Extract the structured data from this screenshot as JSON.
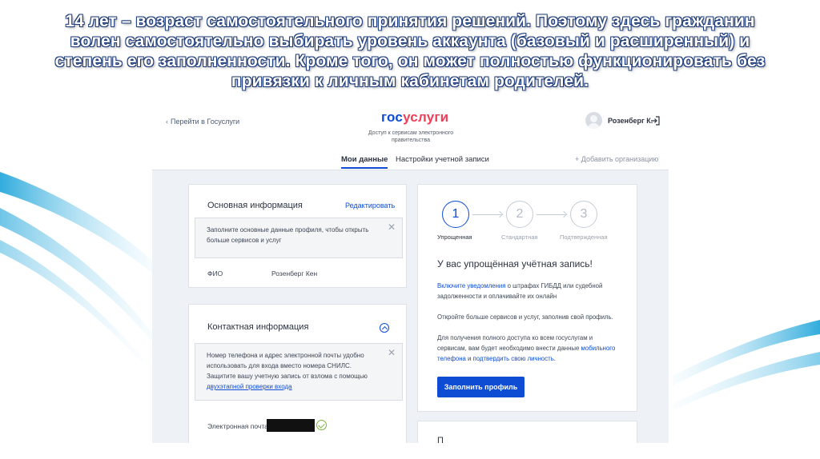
{
  "slide": {
    "heading": "14 лет – возраст самостоятельного принятия решений. Поэтому здесь гражданин волен самостоятельно выбирать уровень аккаунта (базовый и расширенный) и степень его заполненности. Кроме того, он может полностью функционировать без привязки к личным кабинетам родителей."
  },
  "header": {
    "back_link": "Перейти в Госуслуги",
    "logo_part1": "гос",
    "logo_part2": "услуги",
    "tagline": "Доступ к сервисам электронного правительства",
    "user_name": "Розенберг К."
  },
  "tabs": [
    {
      "label": "Мои данные"
    },
    {
      "label": "Настройки учетной записи"
    }
  ],
  "add_org": "+ Добавить организацию",
  "basic_info": {
    "title": "Основная информация",
    "edit": "Редактировать",
    "notice": "Заполните основные данные профиля, чтобы открыть больше сервисов и услуг",
    "fio_label": "ФИО",
    "fio_value": "Розенберг Кен"
  },
  "contact_info": {
    "title": "Контактная информация",
    "notice_line1": "Номер телефона и адрес электронной почты удобно использовать для входа вместо номера СНИЛС.",
    "notice_line2": "Защитите вашу учетную запись от взлома с помощью",
    "notice_link": "двухэтапной проверки входа",
    "email_label": "Электронная почта"
  },
  "account_status": {
    "steps": [
      {
        "number": "1",
        "label": "Упрощенная"
      },
      {
        "number": "2",
        "label": "Стандартная"
      },
      {
        "number": "3",
        "label": "Подтвержденная"
      }
    ],
    "title": "У вас упрощённая учётная запись!",
    "p1_link": "Включите уведомления",
    "p1_text": " о штрафах ГИБДД или судебной задолженности и оплачивайте их онлайн",
    "p2": "Откройте больше сервисов и услуг, заполнив свой профиль.",
    "p3_text": "Для получения полного доступа ко всем госуслугам и сервисам, вам будет необходимо внести данные ",
    "p3_link1": "мобильного телефона",
    "p3_mid": " и ",
    "p3_link2": "подтвердить свою личность",
    "p3_end": ".",
    "button": "Заполнить профиль",
    "next_card_title": "П"
  },
  "colors": {
    "brand_blue": "#0d4cd3",
    "brand_red": "#ee3f58",
    "page_bg": "#eef1f5",
    "heading_outline": "#1f3d7a"
  }
}
